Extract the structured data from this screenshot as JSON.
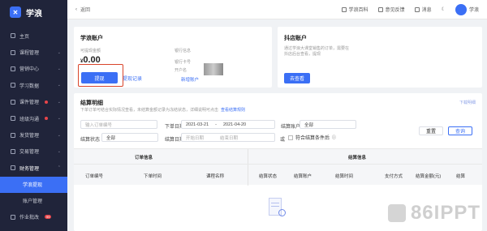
{
  "app": {
    "name": "学浪"
  },
  "sidebar": {
    "items": [
      {
        "label": "主页",
        "arrow": ""
      },
      {
        "label": "课程管理",
        "arrow": "⌄"
      },
      {
        "label": "营销中心",
        "arrow": "⌄"
      },
      {
        "label": "学习数据",
        "arrow": "⌄"
      },
      {
        "label": "课件管理",
        "arrow": "⌄",
        "dot": true
      },
      {
        "label": "班级沟通",
        "arrow": "⌄",
        "dot": true
      },
      {
        "label": "发货管理",
        "arrow": "⌄"
      },
      {
        "label": "交易管理",
        "arrow": "⌄"
      },
      {
        "label": "财务管理",
        "arrow": "⌃"
      }
    ],
    "sub": [
      {
        "label": "学浪提现"
      },
      {
        "label": "账户管理"
      }
    ],
    "last": {
      "label": "作业批改",
      "badge": "99"
    }
  },
  "topbar": {
    "back": "返回",
    "wiki": "学浪百科",
    "feedback": "意见反馈",
    "messages": "消息",
    "user": "学浪"
  },
  "account": {
    "title": "学浪账户",
    "available_label": "可提现金额",
    "currency": "¥",
    "amount": "0.00",
    "withdraw": "提现",
    "withdraw_record": "提现记录",
    "card_label": "银行信息",
    "card_no": "银行卡号",
    "holder": "开户名",
    "add_account": "新增账户"
  },
  "shop": {
    "title": "抖店账户",
    "desc": "通过学浪大课堂销售的订单，需要在抖店后台查看，提现",
    "view": "去查看"
  },
  "detail": {
    "title": "结算明细",
    "subtitle": "下单订单可结合实际情况查看，未结算金额记录为冻结状态，详细说明可点击",
    "help": "查看结算规则",
    "download": "下载明细",
    "order_placeholder": "输入订单编号",
    "order_date_label": "下单日期",
    "date_from": "2021-03-21",
    "date_to": "2021-04-20",
    "settle_account_label": "结算账户",
    "settle_account_value": "全部",
    "settle_status_label": "结算状态",
    "settle_status_value": "全部",
    "settle_date_label": "结算日期",
    "start_placeholder": "开始日期",
    "end_placeholder": "结束日期",
    "or": "或",
    "checkbox_label": "符合结算条件后",
    "reset": "重置",
    "search": "查询",
    "group_order": "订单信息",
    "group_settle": "结算信息",
    "columns": [
      "订单编号",
      "下单时间",
      "课程名称",
      "结算状态",
      "结算账户",
      "结算时间",
      "支付方式",
      "结算金额(元)",
      "结算"
    ]
  }
}
